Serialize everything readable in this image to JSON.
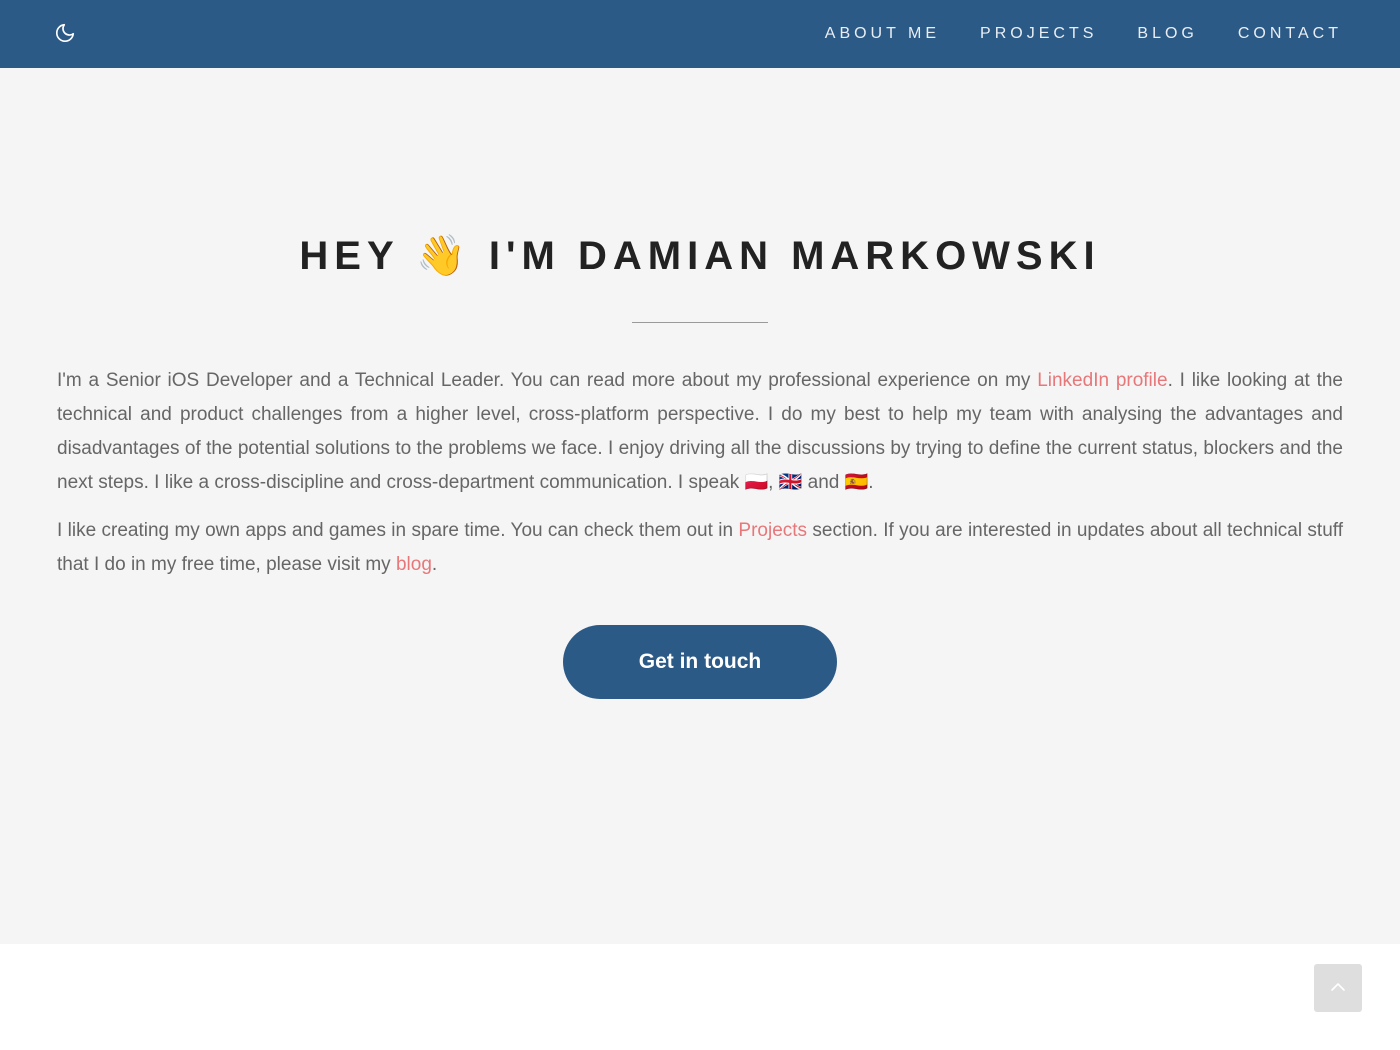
{
  "nav": {
    "theme_toggle_icon": "moon-icon",
    "links": [
      {
        "label": "ABOUT ME"
      },
      {
        "label": "PROJECTS"
      },
      {
        "label": "BLOG"
      },
      {
        "label": "CONTACT"
      }
    ]
  },
  "hero": {
    "title": "HEY 👋 I'M DAMIAN MARKOWSKI",
    "paragraph1": {
      "before_link": "I'm a Senior iOS Developer and a Technical Leader. You can read more about my professional experience on my ",
      "link": "LinkedIn profile",
      "after_link": ". I like looking at the technical and product challenges from a higher level, cross-platform perspective. I do my best to help my team with analysing the advantages and disadvantages of the potential solutions to the problems we face. I enjoy driving all the discussions by trying to define the current status, blockers and the next steps. I like a cross-discipline and cross-department communication. I speak 🇵🇱, 🇬🇧 and 🇪🇸."
    },
    "paragraph2": {
      "before_link": "I like creating my own apps and games in spare time. You can check them out in ",
      "link1": "Projects",
      "middle": " section. If you are interested in updates about all technical stuff that I do in my free time, please visit my ",
      "link2": "blog",
      "after_link": "."
    },
    "cta_label": "Get in touch"
  },
  "scroll_top_icon": "chevron-up-icon",
  "colors": {
    "navbar": "#2c5a87",
    "link": "#e8777a",
    "hero_background": "#f5f5f5"
  }
}
